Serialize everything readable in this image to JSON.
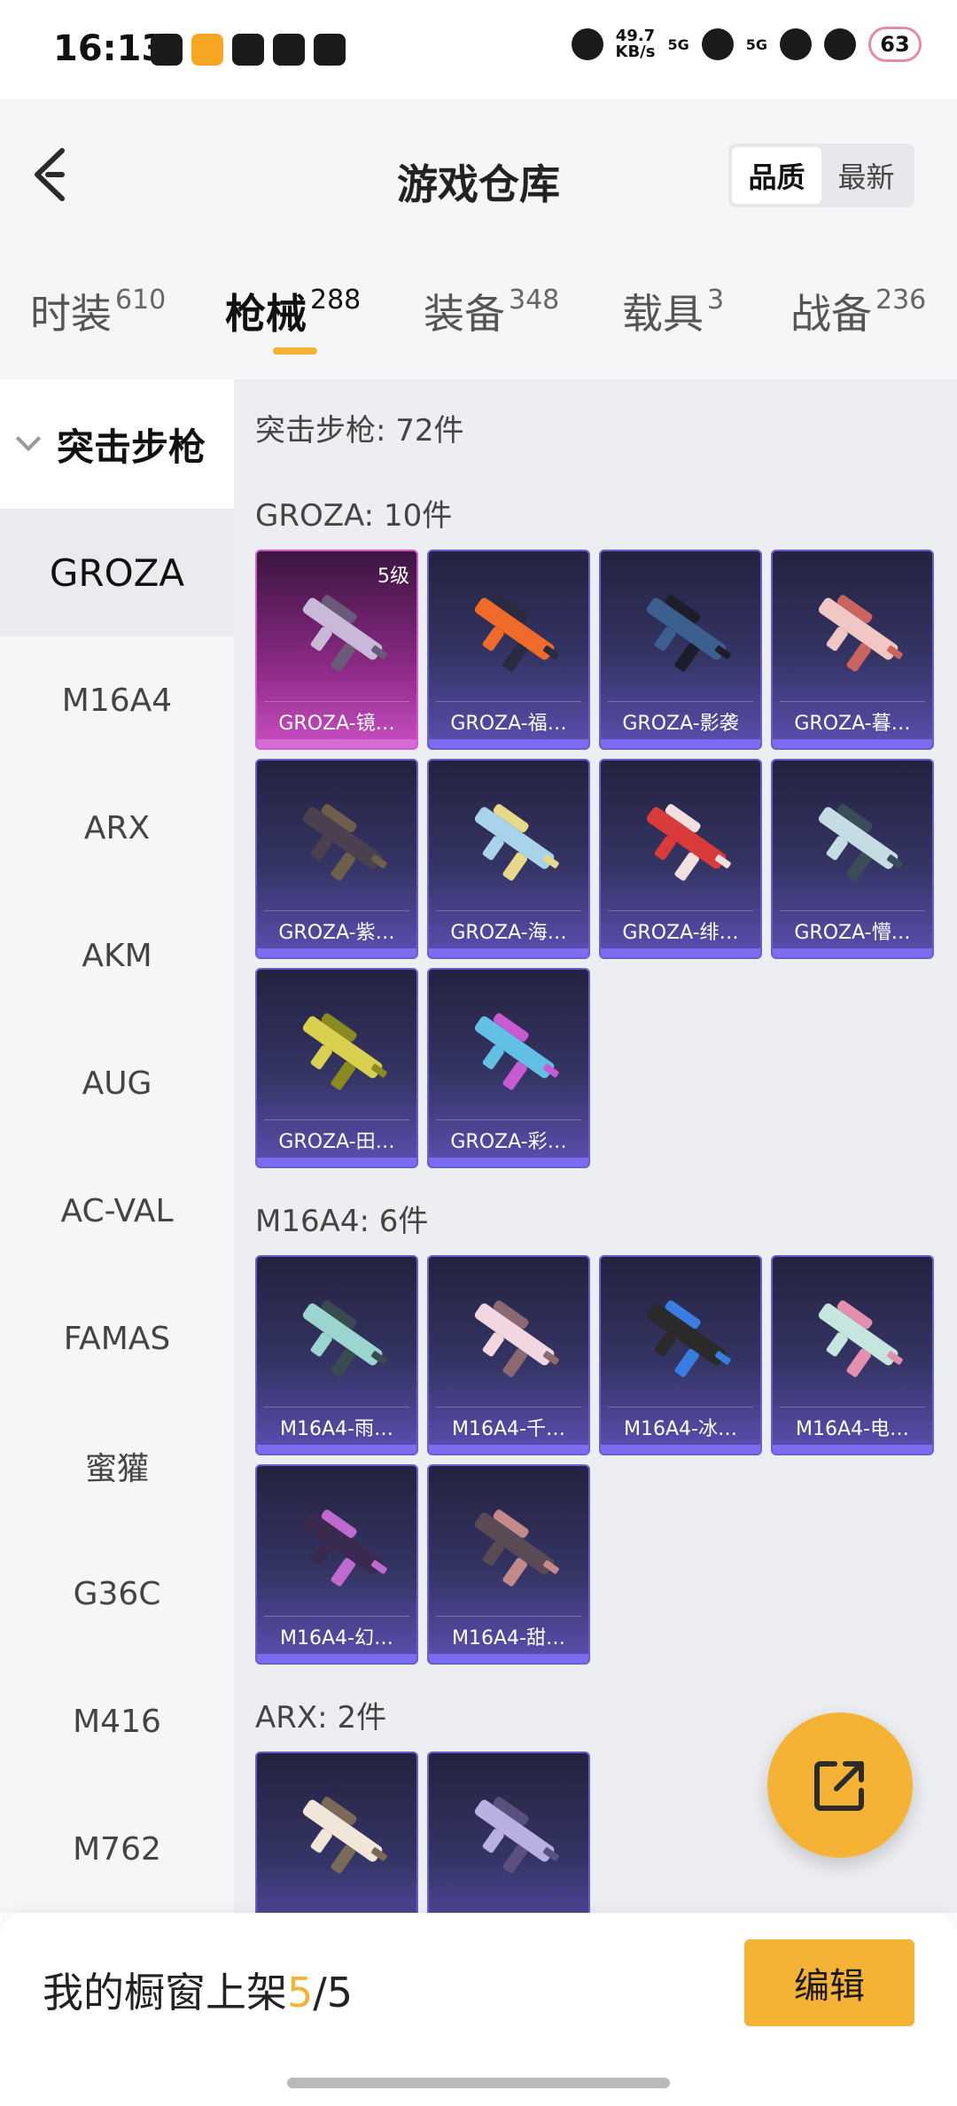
{
  "status_bar": {
    "time": "16:13",
    "speed_value": "49.7",
    "speed_unit": "KB/s",
    "net1": "5G",
    "net2": "5G",
    "battery": "63"
  },
  "header": {
    "title": "游戏仓库",
    "sort_options": [
      "品质",
      "最新"
    ]
  },
  "tabs": [
    {
      "label": "时装",
      "count": "610"
    },
    {
      "label": "枪械",
      "count": "288"
    },
    {
      "label": "装备",
      "count": "348"
    },
    {
      "label": "载具",
      "count": "3"
    },
    {
      "label": "战备",
      "count": "236"
    }
  ],
  "sidebar": {
    "group": "突击步枪",
    "items": [
      "GROZA",
      "M16A4",
      "ARX",
      "AKM",
      "AUG",
      "AC-VAL",
      "FAMAS",
      "蜜獾",
      "G36C",
      "M416",
      "M762"
    ]
  },
  "content": {
    "category_title": "突击步枪: 72件",
    "sections": [
      {
        "title": "GROZA: 10件",
        "items": [
          {
            "label": "GROZA-镜…",
            "level": "5级"
          },
          {
            "label": "GROZA-福…"
          },
          {
            "label": "GROZA-影袭"
          },
          {
            "label": "GROZA-暮…"
          },
          {
            "label": "GROZA-紫…"
          },
          {
            "label": "GROZA-海…"
          },
          {
            "label": "GROZA-绯…"
          },
          {
            "label": "GROZA-懵…"
          },
          {
            "label": "GROZA-田…"
          },
          {
            "label": "GROZA-彩…"
          }
        ]
      },
      {
        "title": "M16A4: 6件",
        "items": [
          {
            "label": "M16A4-雨…"
          },
          {
            "label": "M16A4-千…"
          },
          {
            "label": "M16A4-冰…"
          },
          {
            "label": "M16A4-电…"
          },
          {
            "label": "M16A4-幻…"
          },
          {
            "label": "M16A4-甜…"
          }
        ]
      },
      {
        "title": "ARX: 2件",
        "items": [
          {
            "label": ""
          },
          {
            "label": ""
          }
        ]
      }
    ]
  },
  "bottom_bar": {
    "prefix": "我的橱窗上架",
    "count": "5",
    "total": "/5",
    "edit_label": "编辑"
  },
  "colors": {
    "accent": "#f5b335",
    "card_purple": "#5b4fb2",
    "card_pink": "#c94fc2"
  }
}
